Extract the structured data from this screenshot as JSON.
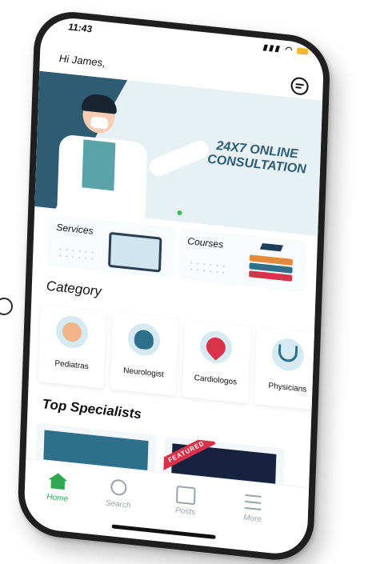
{
  "status": {
    "time": "11:43"
  },
  "header": {
    "greeting": "Hi James,",
    "icons": {
      "chat": "chat-bubble-icon"
    }
  },
  "banner": {
    "title": "24X7 ONLINE CONSULTATION"
  },
  "services": [
    {
      "label": "Services"
    },
    {
      "label": "Courses"
    }
  ],
  "category": {
    "title": "Category",
    "items": [
      {
        "label": "Pediatras",
        "icon": "baby-icon"
      },
      {
        "label": "Neurologist",
        "icon": "brain-icon"
      },
      {
        "label": "Cardiologos",
        "icon": "heart-icon"
      },
      {
        "label": "Physicians",
        "icon": "stethoscope-icon"
      }
    ]
  },
  "specialists": {
    "title": "Top Specialists",
    "cards": [
      {
        "badge": ""
      },
      {
        "badge": "FEATURED"
      }
    ]
  },
  "tabbar": {
    "items": [
      {
        "label": "Home",
        "icon": "home-icon",
        "active": true
      },
      {
        "label": "Search",
        "icon": "search-icon"
      },
      {
        "label": "Posts",
        "icon": "posts-icon"
      },
      {
        "label": "More",
        "icon": "menu-icon"
      }
    ]
  },
  "colors": {
    "accent": "#2fa84f",
    "banner_dark": "#2e5c73",
    "badge": "#d8334a"
  }
}
